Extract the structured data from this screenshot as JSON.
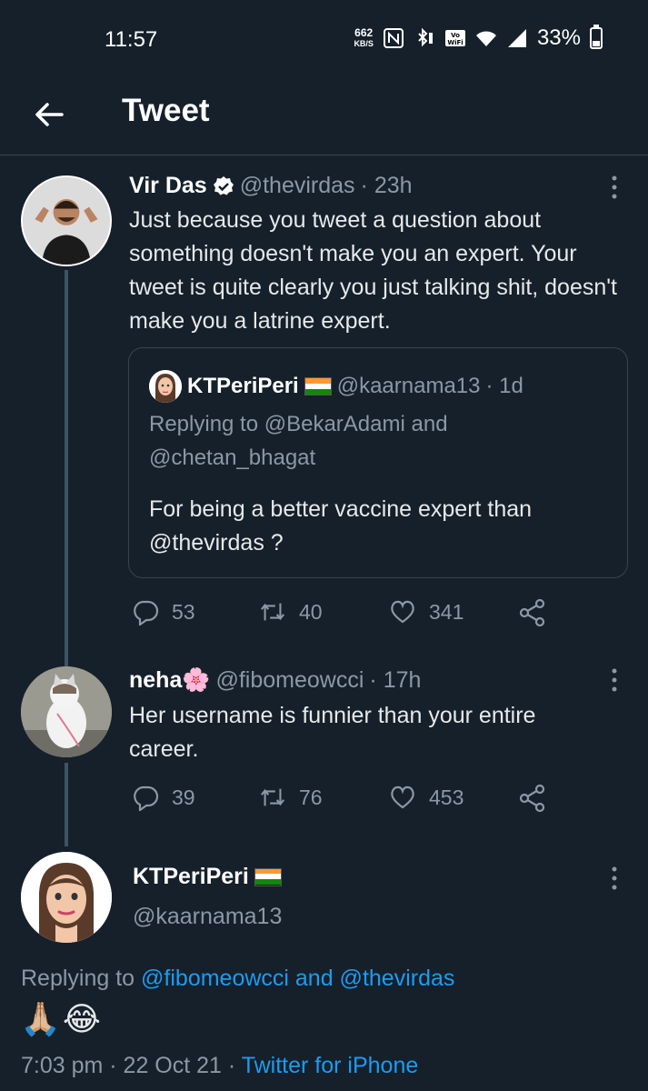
{
  "status_bar": {
    "time": "11:57",
    "net_speed": "662",
    "net_unit": "KB/S",
    "battery": "33%"
  },
  "header": {
    "title": "Tweet"
  },
  "tweet_main": {
    "name": "Vir Das",
    "handle": "@thevirdas",
    "time": "· 23h",
    "text": "Just because you tweet a question about something doesn't make you an expert. Your tweet is quite clearly you just talking shit, doesn't make you a latrine expert.",
    "replies": "53",
    "retweets": "40",
    "likes": "341",
    "quoted": {
      "name": "KTPeriPeri",
      "handle": "@kaarnama13",
      "time": "· 1d",
      "replying_line1": "Replying to @BekarAdami and",
      "replying_line2": "@chetan_bhagat",
      "text_line1": "For being a better vaccine expert than",
      "text_line2": "@thevirdas ?"
    }
  },
  "tweet_reply": {
    "name": "neha🌸",
    "handle": "@fibomeowcci",
    "time": "· 17h",
    "text": "Her username is funnier than your entire career.",
    "replies": "39",
    "retweets": "76",
    "likes": "453"
  },
  "tweet_focus": {
    "name": "KTPeriPeri",
    "handle": "@kaarnama13",
    "replying_prefix": "Replying to ",
    "replying_users": "@fibomeowcci and @thevirdas",
    "text": "🙏🏼😂",
    "timestamp": "7:03 pm · 22 Oct 21 · ",
    "source": "Twitter for iPhone"
  },
  "colors": {
    "background": "#15202b",
    "accent": "#1d9bf0",
    "muted": "#8b98a5",
    "border": "#38444d"
  },
  "icons": [
    "back-arrow-icon",
    "verified-badge-icon",
    "reply-icon",
    "retweet-icon",
    "like-icon",
    "share-icon",
    "more-icon",
    "india-flag-icon"
  ]
}
